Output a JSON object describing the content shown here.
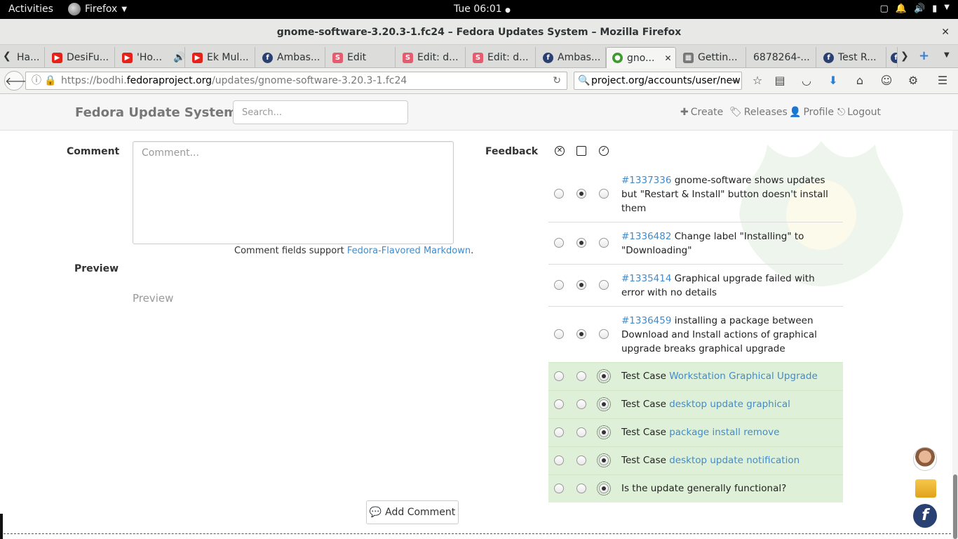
{
  "system_bar": {
    "activities": "Activities",
    "app": "Firefox",
    "clock": "Tue 06:01"
  },
  "window": {
    "title": "gnome-software-3.20.3-1.fc24 – Fedora Updates System – Mozilla Firefox"
  },
  "tabs": [
    {
      "label": "Ha...",
      "icon": "generic"
    },
    {
      "label": "DesiFu...",
      "icon": "youtube"
    },
    {
      "label": "'Ho...",
      "icon": "youtube"
    },
    {
      "label": "Ek Mul...",
      "icon": "youtube"
    },
    {
      "label": "Ambas...",
      "icon": "fedora"
    },
    {
      "label": "Edit",
      "icon": "scribd"
    },
    {
      "label": "Edit: d...",
      "icon": "scribd"
    },
    {
      "label": "Edit: d...",
      "icon": "scribd"
    },
    {
      "label": "Ambas...",
      "icon": "fedora"
    },
    {
      "label": "gno...",
      "icon": "bodhi"
    },
    {
      "label": "Gettin...",
      "icon": "generic"
    },
    {
      "label": "6878264-...",
      "icon": "none"
    },
    {
      "label": "Test R...",
      "icon": "fedora"
    }
  ],
  "urlbar": {
    "prefix": "https://bodhi.",
    "domain": "fedoraproject.org",
    "path": "/updates/gnome-software-3.20.3-1.fc24"
  },
  "searchbar": {
    "value": "project.org/accounts/user/new"
  },
  "site": {
    "brand": "Fedora Update System",
    "search_placeholder": "Search...",
    "nav": {
      "create": "Create",
      "releases": "Releases",
      "profile": "Profile",
      "logout": "Logout"
    }
  },
  "form": {
    "comment_label": "Comment",
    "comment_placeholder": "Comment...",
    "markdown_note_prefix": "Comment fields support ",
    "markdown_link": "Fedora-Flavored Markdown",
    "markdown_note_suffix": ".",
    "preview_label": "Preview",
    "preview_text": "Preview",
    "feedback_label": "Feedback",
    "submit_label": "Add Comment"
  },
  "feedback_rows": [
    {
      "kind": "bug",
      "id": "#1337336",
      "text": "gnome-software shows updates but \"Restart & Install\" button doesn't install them",
      "selected": "neutral"
    },
    {
      "kind": "bug",
      "id": "#1336482",
      "text": "Change label \"Installing\" to \"Downloading\"",
      "selected": "neutral"
    },
    {
      "kind": "bug",
      "id": "#1335414",
      "text": "Graphical upgrade failed with error with no details",
      "selected": "neutral"
    },
    {
      "kind": "bug",
      "id": "#1336459",
      "text": "installing a package between Download and Install actions of graphical upgrade breaks graphical upgrade",
      "selected": "neutral"
    },
    {
      "kind": "testcase",
      "prefix": "Test Case",
      "link": "Workstation Graphical Upgrade",
      "selected": "positive"
    },
    {
      "kind": "testcase",
      "prefix": "Test Case",
      "link": "desktop update graphical",
      "selected": "positive"
    },
    {
      "kind": "testcase",
      "prefix": "Test Case",
      "link": "package install remove",
      "selected": "positive"
    },
    {
      "kind": "testcase",
      "prefix": "Test Case",
      "link": "desktop update notification",
      "selected": "positive"
    },
    {
      "kind": "question",
      "text": "Is the update generally functional?",
      "selected": "positive"
    }
  ],
  "colors": {
    "link": "#428bca",
    "testcase_bg": "#dff0d8",
    "brand_gray": "#777777"
  }
}
